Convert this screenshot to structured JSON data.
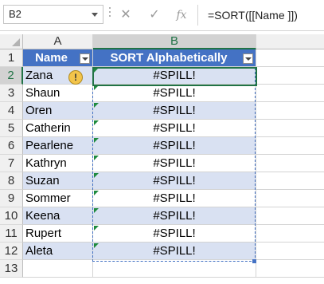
{
  "name_box": "B2",
  "formula_bar": {
    "cancel_symbol": "✕",
    "enter_symbol": "✓",
    "fx_symbol": "fx",
    "formula": "=SORT([[Name ]])"
  },
  "columns": [
    {
      "id": "A"
    },
    {
      "id": "B"
    }
  ],
  "table": {
    "headers": [
      "Name",
      "SORT Alphabetically"
    ],
    "names": [
      "Zana",
      "Shaun",
      "Oren",
      "Catherin",
      "Pearlene",
      "Kathryn",
      "Suzan",
      "Sommer",
      "Keena",
      "Rupert",
      "Aleta"
    ],
    "error_value": "#SPILL!",
    "warning_icon_symbol": "!"
  },
  "rows": [
    "1",
    "2",
    "3",
    "4",
    "5",
    "6",
    "7",
    "8",
    "9",
    "10",
    "11",
    "12",
    "13"
  ],
  "colors": {
    "table_header": "#4472c4",
    "band": "#d9e1f2",
    "selection": "#217346",
    "spill_border": "#4472c4"
  }
}
